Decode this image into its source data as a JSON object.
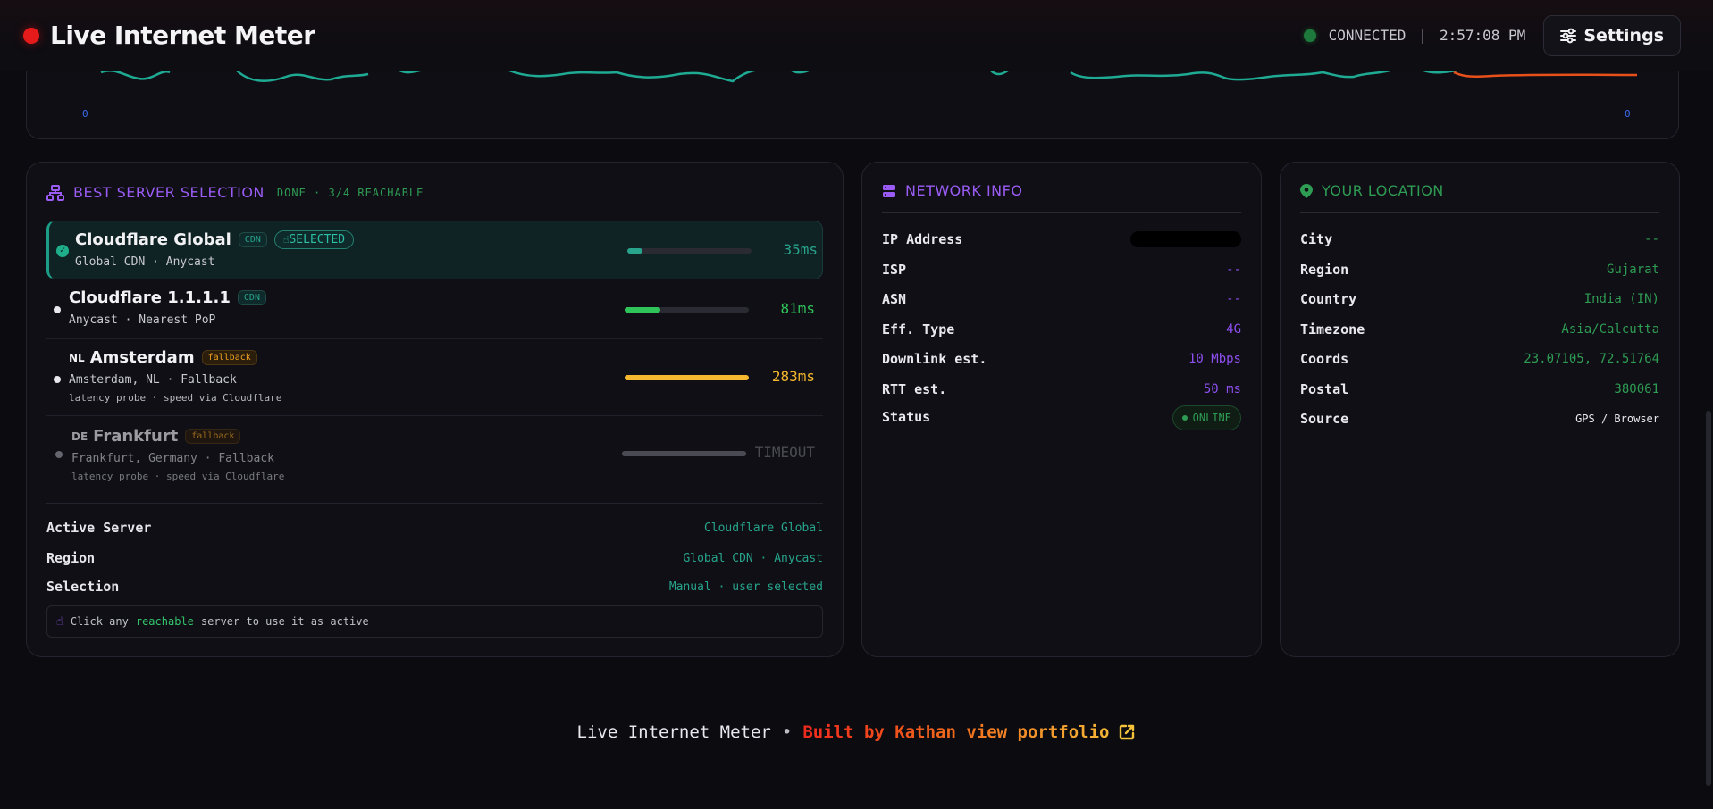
{
  "header": {
    "title": "Live Internet Meter",
    "status": "CONNECTED",
    "separator": "|",
    "time": "2:57:08 PM",
    "settings_label": "Settings"
  },
  "graph": {
    "left_axis_label": "0",
    "right_axis_label": "0"
  },
  "servers_panel": {
    "title": "BEST SERVER SELECTION",
    "status": "DONE · 3/4 REACHABLE",
    "servers": [
      {
        "name": "Cloudflare Global",
        "flag": "",
        "tag": "CDN",
        "selected_label": "SELECTED",
        "sub": "Global CDN · Anycast",
        "note": "",
        "latency": "35ms",
        "bar_fraction": 0.12,
        "color": "#27a48b"
      },
      {
        "name": "Cloudflare 1.1.1.1",
        "flag": "",
        "tag": "CDN",
        "sub": "Anycast · Nearest PoP",
        "note": "",
        "latency": "81ms",
        "bar_fraction": 0.29,
        "color": "#2fc45a"
      },
      {
        "name": "Amsterdam",
        "flag": "NL",
        "tag": "fallback",
        "sub": "Amsterdam, NL · Fallback",
        "note": "latency probe · speed via Cloudflare",
        "latency": "283ms",
        "bar_fraction": 1.0,
        "color": "#f5b82e"
      },
      {
        "name": "Frankfurt",
        "flag": "DE",
        "tag": "fallback",
        "sub": "Frankfurt, Germany · Fallback",
        "note": "latency probe · speed via Cloudflare",
        "latency": "TIMEOUT",
        "bar_fraction": 1.0,
        "color": "#6f6f78"
      }
    ],
    "details": [
      {
        "key": "Active Server",
        "value": "Cloudflare Global"
      },
      {
        "key": "Region",
        "value": "Global CDN · Anycast"
      },
      {
        "key": "Selection",
        "value": "Manual · user selected"
      }
    ],
    "hint": {
      "prefix": "Click any",
      "highlight": "reachable",
      "suffix": "server to use it as active"
    }
  },
  "network_panel": {
    "title": "NETWORK INFO",
    "rows": [
      {
        "key": "IP Address",
        "value": ""
      },
      {
        "key": "ISP",
        "value": "--"
      },
      {
        "key": "ASN",
        "value": "--"
      },
      {
        "key": "Eff. Type",
        "value": "4G"
      },
      {
        "key": "Downlink est.",
        "value": "10 Mbps"
      },
      {
        "key": "RTT est.",
        "value": "50 ms"
      },
      {
        "key": "Status",
        "value": "ONLINE"
      }
    ]
  },
  "location_panel": {
    "title": "YOUR LOCATION",
    "rows": [
      {
        "key": "City",
        "value": "--"
      },
      {
        "key": "Region",
        "value": "Gujarat"
      },
      {
        "key": "Country",
        "value": "India (IN)"
      },
      {
        "key": "Timezone",
        "value": "Asia/Calcutta"
      },
      {
        "key": "Coords",
        "value": "23.07105, 72.51764"
      },
      {
        "key": "Postal",
        "value": "380061"
      },
      {
        "key": "Source",
        "value": "GPS / Browser"
      }
    ]
  },
  "footer": {
    "app_name": "Live Internet Meter",
    "dot": "•",
    "credit": "Built by Kathan view portfolio",
    "icon": "external-link-icon"
  },
  "colors": {
    "accent_purple": "#9a5cf5",
    "accent_green": "#2f9c54",
    "teal": "#27a48b",
    "record_red": "#e51a1a"
  }
}
